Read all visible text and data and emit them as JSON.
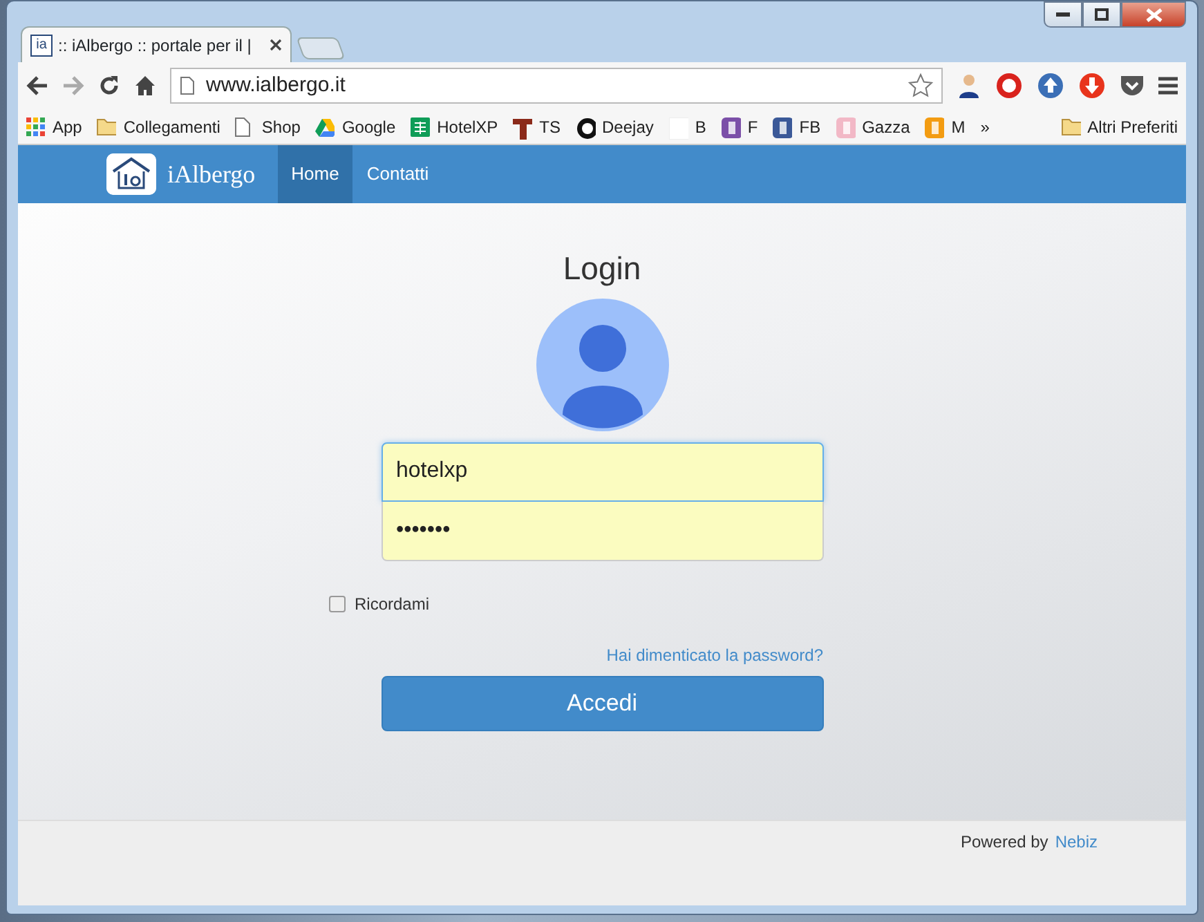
{
  "window": {
    "favicon_text": "ia",
    "tab_title": ":: iAlbergo :: portale per il |"
  },
  "address_bar": {
    "url": "www.ialbergo.it"
  },
  "bookmarks": [
    {
      "kind": "apps",
      "label": "App"
    },
    {
      "kind": "folder",
      "label": "Collegamenti"
    },
    {
      "kind": "page",
      "label": "Shop"
    },
    {
      "kind": "drive",
      "label": "Google"
    },
    {
      "kind": "sheet",
      "label": "HotelXP",
      "color": "#0f9d58"
    },
    {
      "kind": "letter",
      "label": "TS",
      "color": "#8b2a1a"
    },
    {
      "kind": "disc",
      "label": "Deejay",
      "color": "#111111"
    },
    {
      "kind": "blank",
      "label": "B",
      "color": "#ffffff"
    },
    {
      "kind": "badge",
      "label": "F",
      "color": "#7b4fa8"
    },
    {
      "kind": "badge",
      "label": "FB",
      "color": "#3b5998"
    },
    {
      "kind": "badge",
      "label": "Gazza",
      "color": "#f2b8c6"
    },
    {
      "kind": "badge",
      "label": "M",
      "color": "#f39c12"
    },
    {
      "kind": "more",
      "label": "»"
    },
    {
      "kind": "folder",
      "label": "Altri Preferiti"
    }
  ],
  "navbar": {
    "brand": "iAlbergo",
    "items": [
      {
        "label": "Home",
        "selected": true
      },
      {
        "label": "Contatti",
        "selected": false
      }
    ]
  },
  "login": {
    "title": "Login",
    "username": {
      "value": "hotelxp"
    },
    "password": {
      "value": "•••••••"
    },
    "remember": {
      "label": "Ricordami",
      "checked": false
    },
    "forgot_link": "Hai dimenticato la password?",
    "submit": "Accedi"
  },
  "footer": {
    "text": "Powered by",
    "link": "Nebiz"
  }
}
